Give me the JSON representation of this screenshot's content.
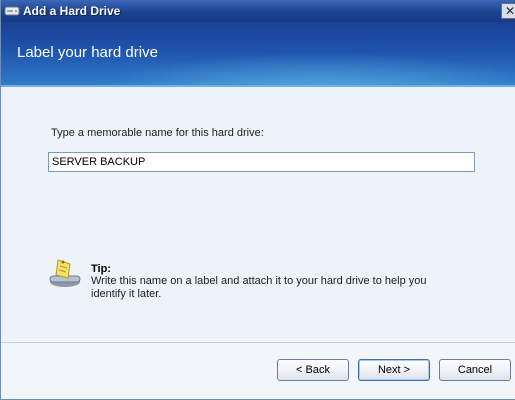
{
  "window": {
    "title": "Add a Hard Drive",
    "close_glyph": "✕"
  },
  "banner": {
    "title": "Label your hard drive"
  },
  "form": {
    "prompt": "Type a memorable name for this hard drive:",
    "name_value": "SERVER BACKUP"
  },
  "tip": {
    "icon": "tip-label-icon",
    "title": "Tip:",
    "body": "Write this name on a label and attach it to your hard drive to help you identify it later."
  },
  "buttons": {
    "back": "< Back",
    "next": "Next >",
    "cancel": "Cancel"
  },
  "colors": {
    "titlebar": "#1c4290",
    "banner": "#1f54ad",
    "content_bg": "#eef3fa"
  }
}
